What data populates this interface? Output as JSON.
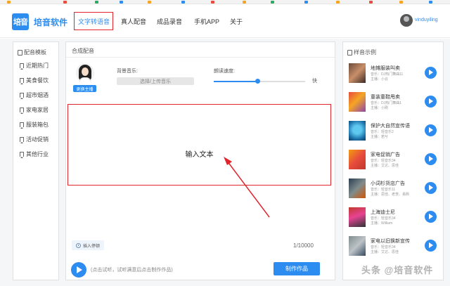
{
  "header": {
    "logo_text": "培音",
    "brand": "培音软件",
    "nav": [
      "文字转语音",
      "真人配音",
      "成品录音",
      "手机APP",
      "关于"
    ],
    "active_nav": "文字转语音",
    "username": "vinduyiling"
  },
  "left": {
    "title": "配音模板",
    "categories": [
      "近期热门",
      "美食餐饮",
      "超市烟酒",
      "家电家居",
      "服装箱包",
      "活动促销",
      "其他行业"
    ]
  },
  "center": {
    "title": "合成配音",
    "swap_voice": "更换主播",
    "bgm_label": "背景音乐:",
    "bgm_button": "选择/上传音乐",
    "speed_label": "朗读速度:",
    "speed_fast": "快",
    "speed_value": 0.48,
    "text_placeholder": "输入文本",
    "insert_pause": "插入停顿",
    "char_count": "1/10000",
    "hint": "(点击试听，试听满意后点击制作作品)",
    "make_button": "制作作品"
  },
  "right": {
    "title": "样音示例",
    "samples": [
      {
        "title": "地摊服装叫卖",
        "music": "音乐：DJ热门舞曲11",
        "voice": "主播：小云"
      },
      {
        "title": "童装童鞋甩卖",
        "music": "音乐：DJ热门舞曲1",
        "voice": "主播：小刚"
      },
      {
        "title": "保护大自然宣传语",
        "music": "音乐：轻音乐2",
        "voice": "主播：若兮"
      },
      {
        "title": "家电促销广告",
        "music": "音乐：轻音乐34",
        "voice": "主播：艾达、思佳"
      },
      {
        "title": "小词杉货店广告",
        "music": "音乐：轻音乐11",
        "voice": "主播：思佳、老李、易熙"
      },
      {
        "title": "上海迪士尼",
        "music": "音乐：轻音乐34",
        "voice": "主播：William"
      },
      {
        "title": "家电以旧换新宣传",
        "music": "音乐：轻音乐34",
        "voice": "主播：艾达、思佳"
      }
    ]
  },
  "watermark": "头条 @培音软件",
  "colors": {
    "accent": "#2d8cf0",
    "highlight": "#e0242b"
  }
}
